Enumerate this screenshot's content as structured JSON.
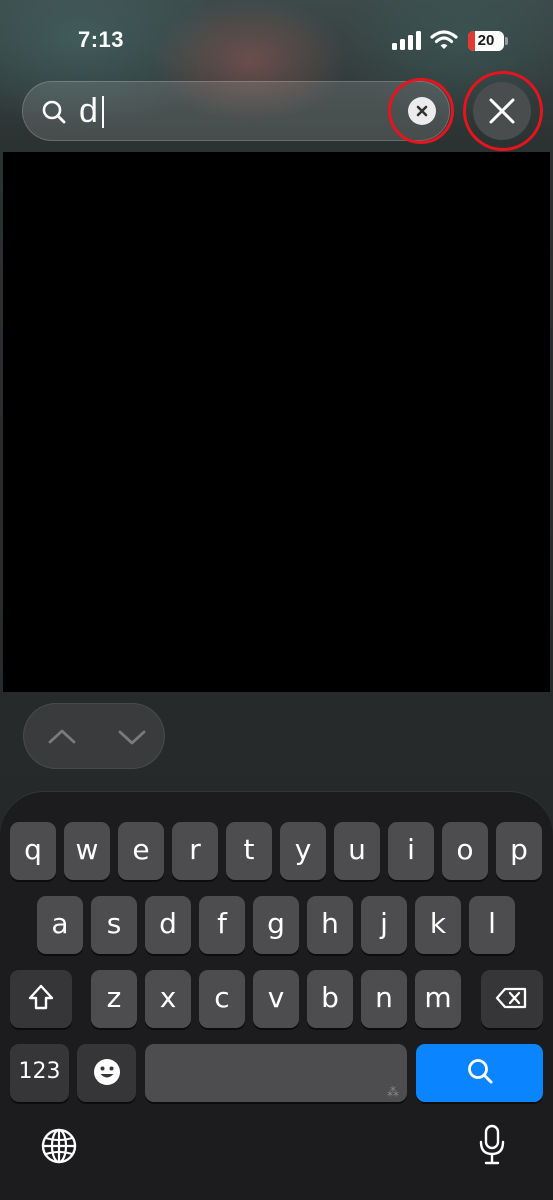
{
  "status_bar": {
    "time": "7:13",
    "battery_percent": "20",
    "battery_level": 0.2,
    "battery_color": "#e23a32",
    "icons": [
      "cellular-signal-icon",
      "wifi-icon",
      "battery-icon"
    ]
  },
  "search": {
    "query": "d",
    "icon": "search-icon",
    "clear_icon": "clear-x-circle-icon",
    "close_icon": "close-x-icon",
    "highlight_color": "#e8141c"
  },
  "navigation": {
    "previous_icon": "chevron-up-icon",
    "next_icon": "chevron-down-icon"
  },
  "keyboard": {
    "row1": [
      "q",
      "w",
      "e",
      "r",
      "t",
      "y",
      "u",
      "i",
      "o",
      "p"
    ],
    "row2": [
      "a",
      "s",
      "d",
      "f",
      "g",
      "h",
      "j",
      "k",
      "l"
    ],
    "row3": [
      "z",
      "x",
      "c",
      "v",
      "b",
      "n",
      "m"
    ],
    "numbers_key": "123",
    "space_hint": "⁂",
    "search_key_color": "#0a84ff",
    "icons": [
      "shift-icon",
      "delete-icon",
      "emoji-icon",
      "search-icon",
      "globe-icon",
      "microphone-icon"
    ]
  }
}
